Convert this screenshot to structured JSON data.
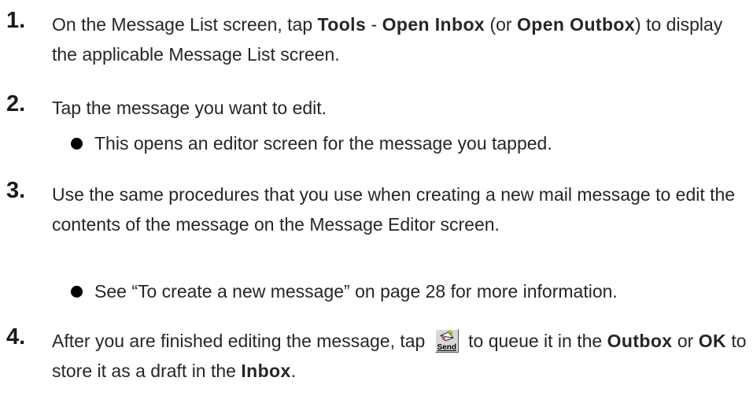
{
  "steps": [
    {
      "number": "1.",
      "parts": {
        "a": "On the Message List screen, tap ",
        "b": "Tools",
        "c": " - ",
        "d": "Open Inbox",
        "e": " (or ",
        "f": "Open Outbox",
        "g": ") to display the applicable Message List screen."
      }
    },
    {
      "number": "2.",
      "text": "Tap the message you want to edit.",
      "bullet": "This opens an editor screen for the message you tapped."
    },
    {
      "number": "3.",
      "text": "Use the same procedures that you use when creating a new mail message to edit the contents of the message on the Message Editor screen.",
      "bullet": "See “To create a new message” on page 28 for more information."
    },
    {
      "number": "4.",
      "parts": {
        "a": "After you are finished editing the message, tap ",
        "icon_label": "Send",
        "b": " to queue it in the ",
        "c": "Outbox",
        "d": " or ",
        "e": "OK",
        "f": " to store it as a draft in the ",
        "g": "Inbox",
        "h": "."
      },
      "icon": "send-mail-icon"
    }
  ]
}
